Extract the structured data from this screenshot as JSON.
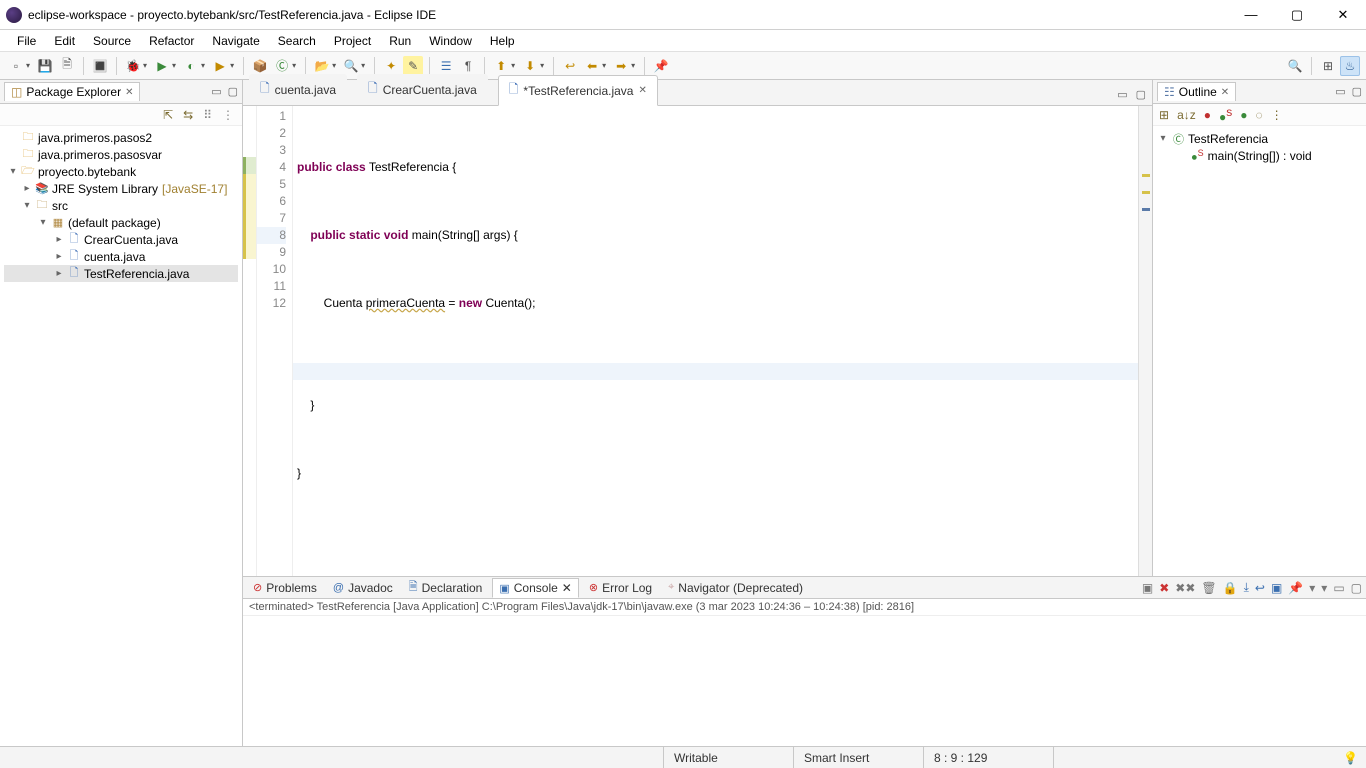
{
  "window": {
    "title": "eclipse-workspace - proyecto.bytebank/src/TestReferencia.java - Eclipse IDE"
  },
  "menu": [
    "File",
    "Edit",
    "Source",
    "Refactor",
    "Navigate",
    "Search",
    "Project",
    "Run",
    "Window",
    "Help"
  ],
  "package_explorer": {
    "title": "Package Explorer",
    "nodes": {
      "p1": "java.primeros.pasos2",
      "p2": "java.primeros.pasosvar",
      "p3": "proyecto.bytebank",
      "jre": "JRE System Library",
      "jre_extra": "[JavaSE-17]",
      "src": "src",
      "pkg": "(default package)",
      "f1": "CrearCuenta.java",
      "f2": "cuenta.java",
      "f3": "TestReferencia.java"
    }
  },
  "editor": {
    "tabs": [
      {
        "label": "cuenta.java",
        "dirty": false,
        "active": false
      },
      {
        "label": "CrearCuenta.java",
        "dirty": false,
        "active": false
      },
      {
        "label": "*TestReferencia.java",
        "dirty": true,
        "active": true
      }
    ],
    "line_count": 12,
    "current_line": 8,
    "code": {
      "l1": "",
      "l2a": "public",
      "l2b": " ",
      "l2c": "class",
      "l2d": " TestReferencia {",
      "l3": "",
      "l4a": "    ",
      "l4b": "public",
      "l4c": " ",
      "l4d": "static",
      "l4e": " ",
      "l4f": "void",
      "l4g": " main(String[] args) {",
      "l5": "",
      "l6a": "        Cuenta ",
      "l6b": "primeraCuenta",
      "l6c": " = ",
      "l6d": "new",
      "l6e": " Cuenta();",
      "l7": "",
      "l8": "        ",
      "l9": "    }",
      "l10": "",
      "l11": "}",
      "l12": ""
    }
  },
  "outline": {
    "title": "Outline",
    "class": "TestReferencia",
    "method": "main(String[]) : void"
  },
  "bottom": {
    "tabs": {
      "problems": "Problems",
      "javadoc": "Javadoc",
      "declaration": "Declaration",
      "console": "Console",
      "errorlog": "Error Log",
      "navigator": "Navigator (Deprecated)"
    },
    "console_status": "<terminated> TestReferencia [Java Application] C:\\Program Files\\Java\\jdk-17\\bin\\javaw.exe (3 mar 2023 10:24:36 – 10:24:38) [pid: 2816]"
  },
  "status": {
    "writable": "Writable",
    "insert": "Smart Insert",
    "position": "8 : 9 : 129"
  }
}
